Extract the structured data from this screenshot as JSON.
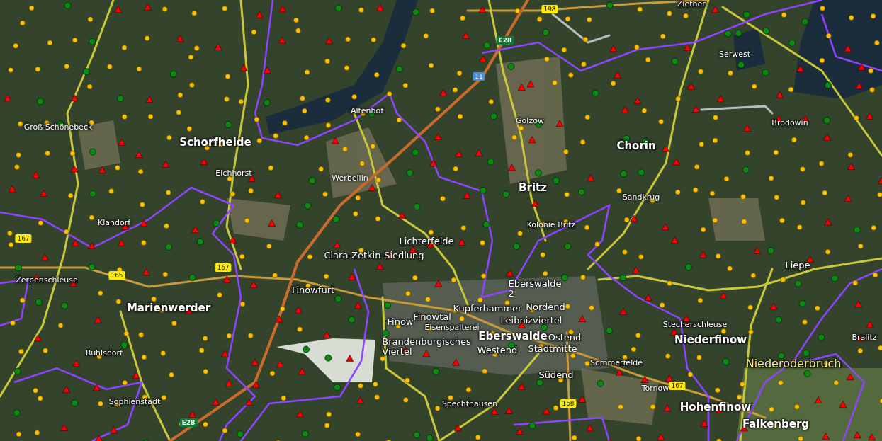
{
  "map": {
    "labels": [
      {
        "text": "Groß Schönebeck",
        "kind": "village"
      },
      {
        "text": "Schorfheide",
        "kind": "town"
      },
      {
        "text": "Eichhorst",
        "kind": "village"
      },
      {
        "text": "Altenhof",
        "kind": "village"
      },
      {
        "text": "Werbellin",
        "kind": "village"
      },
      {
        "text": "Golzow",
        "kind": "village"
      },
      {
        "text": "Britz",
        "kind": "town"
      },
      {
        "text": "Chorin",
        "kind": "town"
      },
      {
        "text": "Sandkrug",
        "kind": "village"
      },
      {
        "text": "Brodowin",
        "kind": "village"
      },
      {
        "text": "Serwest",
        "kind": "village"
      },
      {
        "text": "Ziethen",
        "kind": "village"
      },
      {
        "text": "Klandorf",
        "kind": "village"
      },
      {
        "text": "Kolonie Britz",
        "kind": "village"
      },
      {
        "text": "Lichterfelde",
        "kind": "district"
      },
      {
        "text": "Clara-Zetkin-Siedlung",
        "kind": "district"
      },
      {
        "text": "Liepe",
        "kind": "district"
      },
      {
        "text": "Zerpenschleuse",
        "kind": "village"
      },
      {
        "text": "Finowfurt",
        "kind": "district"
      },
      {
        "text": "Eberswalde 2",
        "kind": "district"
      },
      {
        "text": "Marienwerder",
        "kind": "town"
      },
      {
        "text": "Kupferhammer",
        "kind": "district"
      },
      {
        "text": "Nordend",
        "kind": "district"
      },
      {
        "text": "Finow",
        "kind": "district"
      },
      {
        "text": "Finowtal",
        "kind": "district"
      },
      {
        "text": "Leibnizviertel",
        "kind": "district"
      },
      {
        "text": "Stecherschleuse",
        "kind": "village"
      },
      {
        "text": "Eisenspalterei",
        "kind": "village"
      },
      {
        "text": "Eberswalde",
        "kind": "town"
      },
      {
        "text": "Ostend",
        "kind": "district"
      },
      {
        "text": "Niederfinow",
        "kind": "town"
      },
      {
        "text": "Bralitz",
        "kind": "village"
      },
      {
        "text": "Brandenburgisches Viertel",
        "kind": "district"
      },
      {
        "text": "Westend",
        "kind": "district"
      },
      {
        "text": "Stadtmitte",
        "kind": "district"
      },
      {
        "text": "Ruhlsdorf",
        "kind": "village"
      },
      {
        "text": "Sommerfelde",
        "kind": "village"
      },
      {
        "text": "Niederoderbruch",
        "kind": "region"
      },
      {
        "text": "Südend",
        "kind": "district"
      },
      {
        "text": "Tornow",
        "kind": "village"
      },
      {
        "text": "Sophienstädt",
        "kind": "village"
      },
      {
        "text": "Spechthausen",
        "kind": "village"
      },
      {
        "text": "Hohenfinow",
        "kind": "town"
      },
      {
        "text": "Falkenberg",
        "kind": "town"
      }
    ],
    "road_shields": [
      {
        "text": "198",
        "kind": "federal"
      },
      {
        "text": "E28",
        "kind": "european"
      },
      {
        "text": "11",
        "kind": "motorway"
      },
      {
        "text": "167",
        "kind": "federal"
      },
      {
        "text": "165",
        "kind": "federal"
      },
      {
        "text": "167",
        "kind": "federal"
      },
      {
        "text": "167",
        "kind": "federal"
      },
      {
        "text": "168",
        "kind": "federal"
      },
      {
        "text": "E28",
        "kind": "european"
      }
    ]
  }
}
